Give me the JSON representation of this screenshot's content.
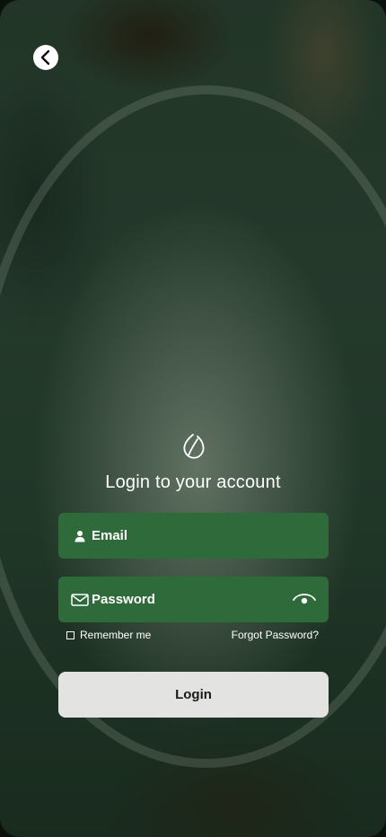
{
  "header": {
    "back_icon": "chevron-left-icon"
  },
  "brand": {
    "logo_icon": "leaf-icon"
  },
  "title": "Login to your account",
  "form": {
    "email": {
      "label": "Email",
      "icon": "user-icon"
    },
    "password": {
      "label": "Password",
      "icon": "envelope-icon",
      "toggle_icon": "eye-icon"
    },
    "remember_label": "Remember me",
    "forgot_label": "Forgot Password?",
    "login_label": "Login"
  },
  "colors": {
    "field_bg": "#2f6a3a",
    "button_bg": "#e3e4e2",
    "text": "#ffffff"
  }
}
